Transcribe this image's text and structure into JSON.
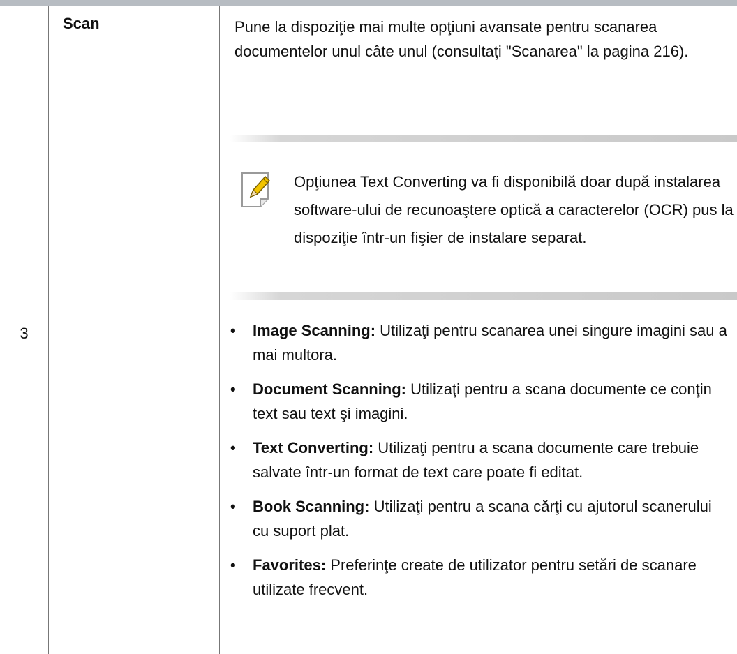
{
  "row": {
    "number": "3",
    "feature": "Scan",
    "description": "Pune la dispoziţie mai multe opţiuni avansate pentru scanarea documentelor unul câte unul (consultaţi \"Scanarea\" la pagina 216).",
    "note": {
      "icon": "pencil-note-icon",
      "text": "Opţiunea Text Converting va fi disponibilă doar după instalarea software-ului de recunoaştere optică a caracterelor (OCR) pus la dispoziţie într-un fişier de instalare separat."
    },
    "options": [
      {
        "term": "Image Scanning:",
        "text": " Utilizaţi pentru scanarea unei singure imagini sau a mai multora."
      },
      {
        "term": "Document Scanning:",
        "text": " Utilizaţi pentru a scana documente ce conţin text sau text şi imagini."
      },
      {
        "term": "Text Converting:",
        "text": " Utilizaţi pentru a scana documente care trebuie salvate într-un format de text care poate fi editat."
      },
      {
        "term": "Book Scanning:",
        "text": " Utilizaţi pentru a scana cărţi cu ajutorul scanerului cu suport plat."
      },
      {
        "term": "Favorites:",
        "text": " Preferinţe create de utilizator pentru setări de scanare utilizate frecvent."
      }
    ]
  }
}
